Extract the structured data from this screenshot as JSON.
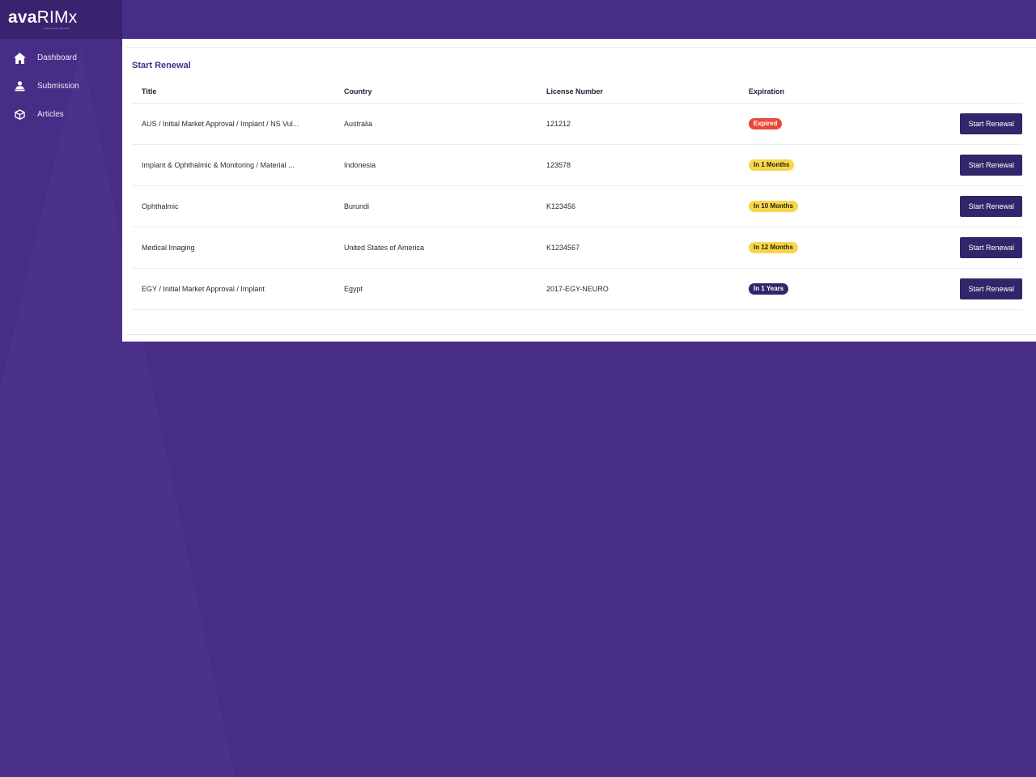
{
  "colors": {
    "background": "#472d86",
    "sidebar_logo_bg": "#3a226f",
    "accent_title": "#4a2d8a",
    "button": "#33256a",
    "badge_expired": "#e64a3a",
    "badge_months": "#f7d74a",
    "badge_years": "#33256a"
  },
  "brand": {
    "prefix": "ava",
    "suffix": "RIMx",
    "tagline": "empowering devices"
  },
  "sidebar": {
    "items": [
      {
        "label": "Dashboard",
        "icon": "home-icon"
      },
      {
        "label": "Submission",
        "icon": "user-stack-icon"
      },
      {
        "label": "Articles",
        "icon": "cube-icon"
      }
    ]
  },
  "main": {
    "title": "Start Renewal",
    "columns": [
      "Title",
      "Country",
      "License Number",
      "Expiration",
      ""
    ],
    "rows": [
      {
        "title": "AUS / Initial Market Approval / Implant / NS Vul...",
        "country": "Australia",
        "license": "121212",
        "expiration": "Expired",
        "status": "red",
        "action": "Start Renewal"
      },
      {
        "title": "Implant & Ophthalmic & Monitoring / Material ...",
        "country": "Indonesia",
        "license": "123578",
        "expiration": "In 1 Months",
        "status": "yellow",
        "action": "Start Renewal"
      },
      {
        "title": "Ophthalmic",
        "country": "Burundi",
        "license": "K123456",
        "expiration": "In 10 Months",
        "status": "yellow",
        "action": "Start Renewal"
      },
      {
        "title": "Medical Imaging",
        "country": "United States of America",
        "license": "K1234567",
        "expiration": "In 12 Months",
        "status": "yellow",
        "action": "Start Renewal"
      },
      {
        "title": "EGY / Initial Market Approval / Implant",
        "country": "Egypt",
        "license": "2017-EGY-NEURO",
        "expiration": "In 1 Years",
        "status": "navy",
        "action": "Start Renewal"
      }
    ]
  }
}
